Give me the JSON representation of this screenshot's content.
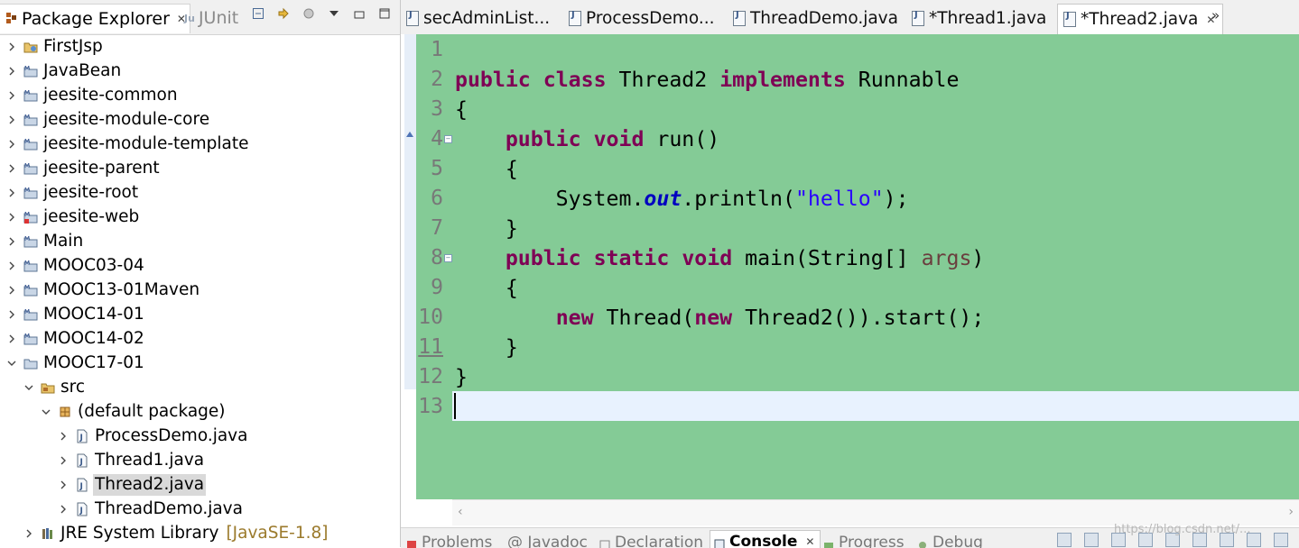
{
  "left_view": {
    "active_tab": "Package Explorer",
    "inactive_tab": "JUnit",
    "close_glyph": "✕",
    "tree": [
      {
        "label": "FirstJsp",
        "icon": "web-project-icon",
        "expanded": false,
        "depth": 0
      },
      {
        "label": "JavaBean",
        "icon": "maven-project-icon",
        "expanded": false,
        "depth": 0
      },
      {
        "label": "jeesite-common",
        "icon": "maven-project-icon",
        "expanded": false,
        "depth": 0
      },
      {
        "label": "jeesite-module-core",
        "icon": "maven-project-icon",
        "expanded": false,
        "depth": 0
      },
      {
        "label": "jeesite-module-template",
        "icon": "maven-project-icon",
        "expanded": false,
        "depth": 0
      },
      {
        "label": "jeesite-parent",
        "icon": "maven-project-icon",
        "expanded": false,
        "depth": 0
      },
      {
        "label": "jeesite-root",
        "icon": "maven-project-icon",
        "expanded": false,
        "depth": 0
      },
      {
        "label": "jeesite-web",
        "icon": "maven-error-project-icon",
        "expanded": false,
        "depth": 0
      },
      {
        "label": "Main",
        "icon": "maven-project-icon",
        "expanded": false,
        "depth": 0
      },
      {
        "label": "MOOC03-04",
        "icon": "maven-project-icon",
        "expanded": false,
        "depth": 0
      },
      {
        "label": "MOOC13-01Maven",
        "icon": "maven-project-icon",
        "expanded": false,
        "depth": 0
      },
      {
        "label": "MOOC14-01",
        "icon": "maven-project-icon",
        "expanded": false,
        "depth": 0
      },
      {
        "label": "MOOC14-02",
        "icon": "maven-project-icon",
        "expanded": false,
        "depth": 0
      },
      {
        "label": "MOOC17-01",
        "icon": "java-project-icon",
        "expanded": true,
        "depth": 0
      },
      {
        "label": "src",
        "icon": "source-folder-icon",
        "expanded": true,
        "depth": 1
      },
      {
        "label": "(default package)",
        "icon": "package-icon",
        "expanded": true,
        "depth": 2
      },
      {
        "label": "ProcessDemo.java",
        "icon": "java-file-icon",
        "expanded": false,
        "depth": 3
      },
      {
        "label": "Thread1.java",
        "icon": "java-file-icon",
        "expanded": false,
        "depth": 3
      },
      {
        "label": "Thread2.java",
        "icon": "java-file-icon",
        "expanded": false,
        "depth": 3,
        "selected": true
      },
      {
        "label": "ThreadDemo.java",
        "icon": "java-file-icon",
        "expanded": false,
        "depth": 3
      },
      {
        "label": "JRE System Library",
        "icon": "library-icon",
        "expanded": false,
        "depth": 1,
        "decoration": "[JavaSE-1.8]"
      }
    ]
  },
  "editor": {
    "tabs": [
      {
        "label": "secAdminList..."
      },
      {
        "label": "ProcessDemo..."
      },
      {
        "label": "ThreadDemo.java"
      },
      {
        "label": "*Thread1.java"
      },
      {
        "label": "*Thread2.java",
        "active": true
      }
    ],
    "overflow_label": "»",
    "line_numbers": [
      "1",
      "2",
      "3",
      "4",
      "5",
      "6",
      "7",
      "8",
      "9",
      "10",
      "11",
      "12",
      "13"
    ],
    "code_lines": [
      [],
      [
        {
          "t": "public",
          "c": "kw"
        },
        {
          "t": " "
        },
        {
          "t": "class",
          "c": "kw"
        },
        {
          "t": " Thread2 "
        },
        {
          "t": "implements",
          "c": "kw"
        },
        {
          "t": " Runnable"
        }
      ],
      [
        {
          "t": "{"
        }
      ],
      [
        {
          "t": "    "
        },
        {
          "t": "public",
          "c": "kw"
        },
        {
          "t": " "
        },
        {
          "t": "void",
          "c": "kw"
        },
        {
          "t": " run()"
        }
      ],
      [
        {
          "t": "    {"
        }
      ],
      [
        {
          "t": "        System."
        },
        {
          "t": "out",
          "c": "field"
        },
        {
          "t": ".println("
        },
        {
          "t": "\"hello\"",
          "c": "str"
        },
        {
          "t": ");"
        }
      ],
      [
        {
          "t": "    }"
        }
      ],
      [
        {
          "t": "    "
        },
        {
          "t": "public",
          "c": "kw"
        },
        {
          "t": " "
        },
        {
          "t": "static",
          "c": "kw"
        },
        {
          "t": " "
        },
        {
          "t": "void",
          "c": "kw"
        },
        {
          "t": " main(String[] "
        },
        {
          "t": "args",
          "c": "param"
        },
        {
          "t": ")"
        }
      ],
      [
        {
          "t": "    {"
        }
      ],
      [
        {
          "t": "        "
        },
        {
          "t": "new",
          "c": "kw"
        },
        {
          "t": " Thread("
        },
        {
          "t": "new",
          "c": "kw"
        },
        {
          "t": " Thread2()).start();"
        }
      ],
      [
        {
          "t": "    }"
        }
      ],
      [
        {
          "t": "}"
        }
      ],
      []
    ],
    "colors": {
      "keyword": "#7f0055",
      "string": "#2a00ff",
      "field": "#0000c0",
      "background": "#84cb96",
      "current_line": "#e8f2fe"
    }
  },
  "bottom_view": {
    "tabs": [
      {
        "label": "Problems",
        "icon": "problems-icon"
      },
      {
        "label": "@ Javadoc",
        "icon": "javadoc-icon"
      },
      {
        "label": "Declaration",
        "icon": "declaration-icon"
      },
      {
        "label": "Console",
        "icon": "console-icon",
        "active": true
      },
      {
        "label": "Progress",
        "icon": "progress-icon"
      },
      {
        "label": "Debug",
        "icon": "debug-icon"
      }
    ],
    "watermark": "https://blog.csdn.net/..."
  }
}
